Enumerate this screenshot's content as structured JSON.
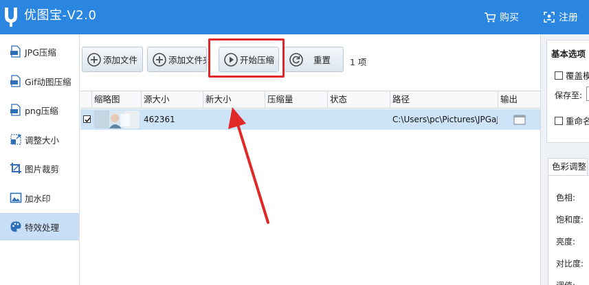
{
  "app": {
    "title": "优图宝-V2.0"
  },
  "titlebar": {
    "buy_label": "购买",
    "register_label": "注册"
  },
  "sidebar": {
    "items": [
      {
        "label": "JPG压缩",
        "icon": "jpg-file-icon"
      },
      {
        "label": "Gif动图压缩",
        "icon": "gif-file-icon"
      },
      {
        "label": "png压缩",
        "icon": "png-file-icon"
      },
      {
        "label": "调整大小",
        "icon": "resize-icon"
      },
      {
        "label": "图片裁剪",
        "icon": "crop-icon"
      },
      {
        "label": "加水印",
        "icon": "watermark-icon"
      },
      {
        "label": "特效处理",
        "icon": "palette-icon",
        "active": true
      }
    ]
  },
  "toolbar": {
    "add_file_label": "添加文件",
    "add_folder_label": "添加文件夹",
    "start_label": "开始压缩",
    "reset_label": "重置",
    "count_label": "1 项"
  },
  "table": {
    "columns": [
      "缩略图",
      "源大小",
      "新大小",
      "压缩量",
      "状态",
      "路径",
      "输出"
    ],
    "rows": [
      {
        "checked": true,
        "source_size": "462361",
        "new_size": "",
        "compression": "",
        "status": "",
        "path": "C:\\Users\\pc\\Pictures\\JPGaJP..."
      }
    ]
  },
  "options": {
    "basic_title": "基本选项",
    "overwrite_label": "覆盖模",
    "save_to_label": "保存至:",
    "rename_label": "重命名",
    "color_tab_label": "色彩调整",
    "adjust_labels": [
      "色相:",
      "饱和度:",
      "亮度:",
      "对比度:",
      "调值:"
    ]
  },
  "colors": {
    "titlebar": "#2b86e2",
    "active_nav": "#c7def6",
    "selected_row": "#cde3f7",
    "annotation_red": "#e02828"
  }
}
